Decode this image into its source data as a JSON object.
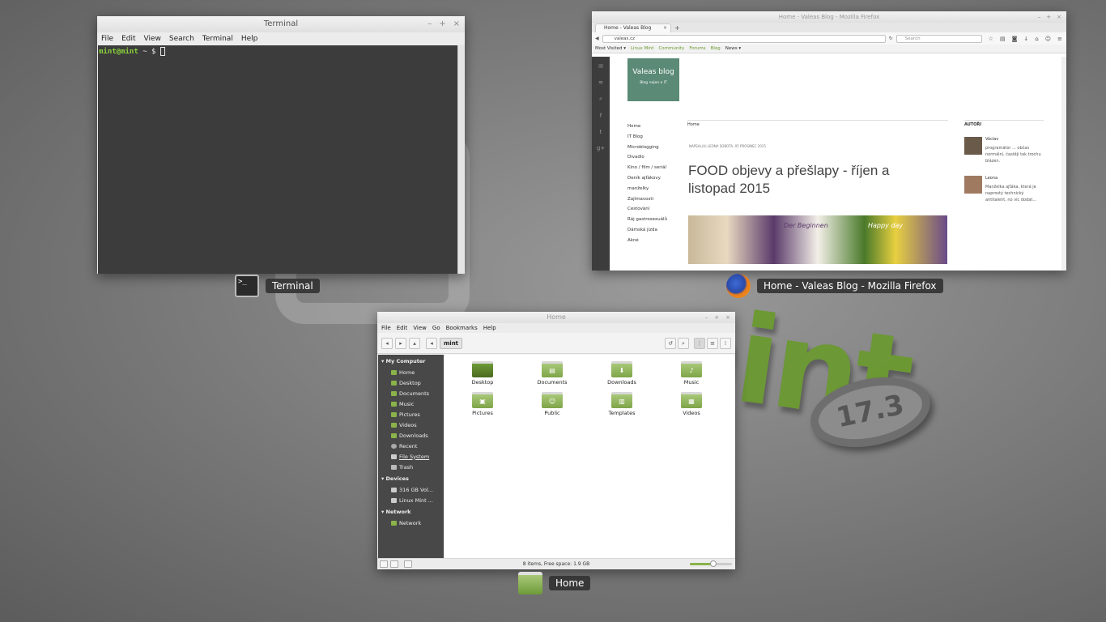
{
  "wallpaper": {
    "badge": "17.3"
  },
  "terminal": {
    "title": "Terminal",
    "window_controls": [
      "–",
      "+",
      "×"
    ],
    "menu": [
      "File",
      "Edit",
      "View",
      "Search",
      "Terminal",
      "Help"
    ],
    "prompt_user": "mint@mint",
    "prompt_rest": " ~ $ ",
    "expo_label": "Terminal"
  },
  "firefox": {
    "title": "Home - Valeas Blog - Mozilla Firefox",
    "window_controls": [
      "–",
      "+",
      "×"
    ],
    "tab_label": "Home - Valeas Blog",
    "tab_close": "×",
    "new_tab": "+",
    "url": "valeas.cz",
    "search_placeholder": "Search",
    "bookmarks": [
      "Most Visited ▾",
      "Linux Mint",
      "Community",
      "Forums",
      "Blog",
      "News ▾"
    ],
    "page": {
      "logo_title": "Valeas blog",
      "logo_subtitle": "Blog nejen o IT",
      "nav": [
        "Home",
        "IT Blog",
        "Microblogging",
        "Divadlo",
        "Kino / film / seriál",
        "Deník ajťákovy",
        "manželky",
        "Zajímavosti",
        "Cestování",
        "Ráj gastrosexuálů",
        "Dámská jízda",
        "Akné"
      ],
      "breadcrumb": "Home",
      "meta": "NAPSAL(A) LEONA     SOBOTA, 05 PROSINEC 2015",
      "post_title": "FOOD objevy a přešlapy - říjen a listopad 2015",
      "image_labels": [
        "Der Beginnen",
        "Happy day"
      ],
      "sidebar_heading": "AUTOŘI",
      "authors": [
        {
          "name": "Václav",
          "desc": "programátor ... občas normální, častěji tak trochu blázen."
        },
        {
          "name": "Leona",
          "desc": "Manželka ajťáka, která je naprostý technický antitalent, no víc dodat..."
        }
      ]
    },
    "expo_label": "Home - Valeas Blog - Mozilla Firefox"
  },
  "nemo": {
    "title": "Home",
    "window_controls": [
      "–",
      "+",
      "×"
    ],
    "menu": [
      "File",
      "Edit",
      "View",
      "Go",
      "Bookmarks",
      "Help"
    ],
    "path_button": "mint",
    "sidebar": {
      "sections": [
        {
          "title": "My Computer",
          "items": [
            "Home",
            "Desktop",
            "Documents",
            "Music",
            "Pictures",
            "Videos",
            "Downloads",
            "Recent",
            "File System",
            "Trash"
          ]
        },
        {
          "title": "Devices",
          "items": [
            "316 GB Vol...",
            "Linux Mint ..."
          ]
        },
        {
          "title": "Network",
          "items": [
            "Network"
          ]
        }
      ]
    },
    "files": [
      "Desktop",
      "Documents",
      "Downloads",
      "Music",
      "Pictures",
      "Public",
      "Templates",
      "Videos"
    ],
    "status": "8 items, Free space: 1.9 GB",
    "zoom_level": 0.55,
    "expo_label": "Home"
  },
  "colors": {
    "mint_green": "#8ab34a",
    "prompt_green": "#8ad33a"
  }
}
